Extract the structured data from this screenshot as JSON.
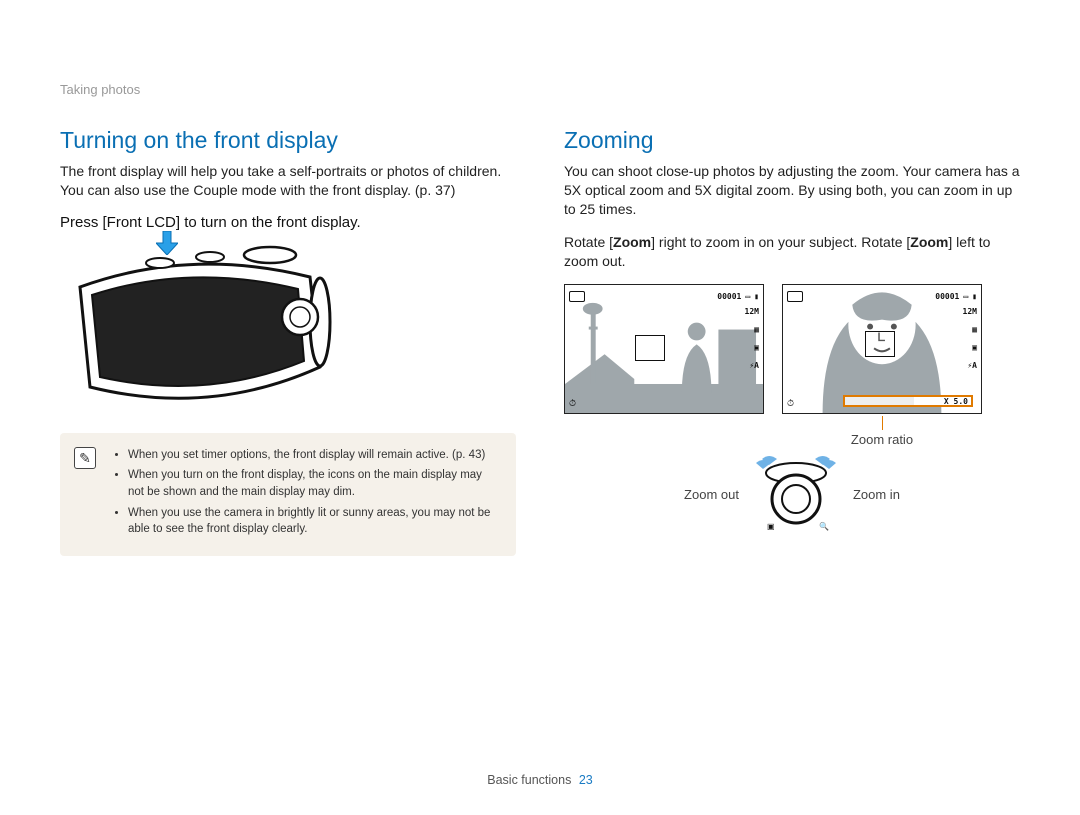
{
  "breadcrumb": "Taking photos",
  "left": {
    "title": "Turning on the front display",
    "body": "The front display will help you take a self-portraits or photos of children. You can also use the Couple mode with the front display. (p. 37)",
    "instruction": "Press [Front LCD] to turn on the front display.",
    "notes": [
      "When you set timer options, the front display will remain active. (p. 43)",
      "When you turn on the front display, the icons on the main display may not be shown and the main display may dim.",
      "When you use the camera in brightly lit or sunny areas, you may not be able to see the front display clearly."
    ]
  },
  "right": {
    "title": "Zooming",
    "body1": "You can shoot close-up photos by adjusting the zoom. Your camera has a 5X optical zoom and 5X digital zoom. By using both, you can zoom in up to 25 times.",
    "body2_pre": "Rotate [",
    "body2_zoom": "Zoom",
    "body2_mid": "] right to zoom in on your subject. Rotate [",
    "body2_post": "] left to zoom out.",
    "counter": "00001",
    "resolution": "12M",
    "flash": "⚡A",
    "timer_icon": "⏱",
    "af_icon": "▣",
    "zoom_ratio_value": "X 5.0",
    "zoom_ratio_label": "Zoom ratio",
    "zoom_out": "Zoom out",
    "zoom_in": "Zoom in"
  },
  "footer": {
    "section": "Basic functions",
    "page": "23"
  }
}
